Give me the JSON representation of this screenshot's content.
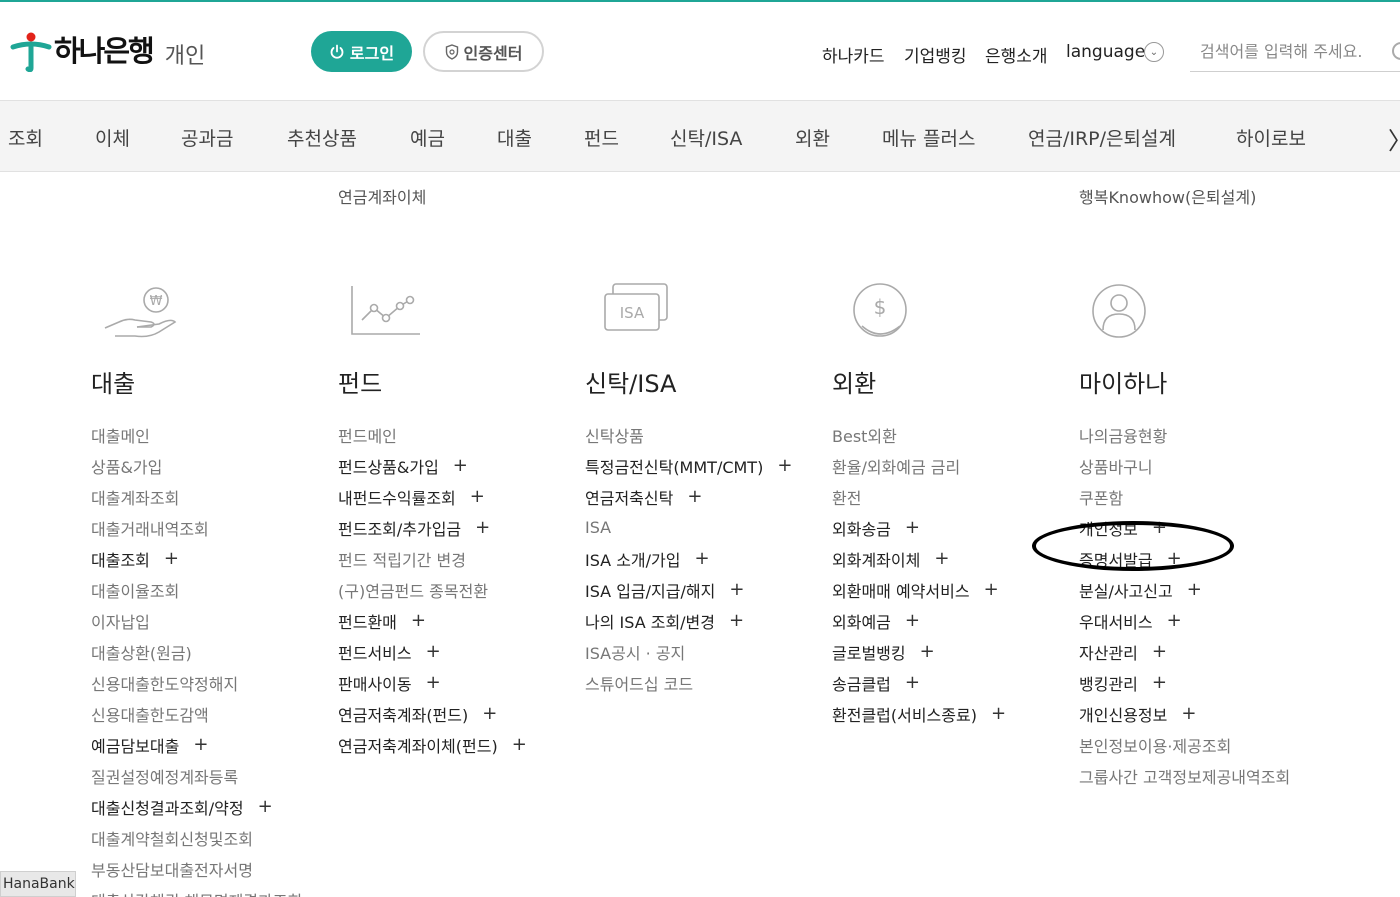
{
  "brand": {
    "name": "하나은행",
    "sub": "개인"
  },
  "header": {
    "login_label": "로그인",
    "cert_label": "인증센터",
    "util_links": [
      "하나카드",
      "기업뱅킹",
      "은행소개",
      "language"
    ],
    "search_placeholder": "검색어를 입력해 주세요."
  },
  "nav": {
    "items": [
      "조회",
      "이체",
      "공과금",
      "추천상품",
      "예금",
      "대출",
      "펀드",
      "신탁/ISA",
      "외환",
      "메뉴 플러스",
      "연금/IRP/은퇴설계",
      "하이로보"
    ],
    "next_symbol": "〉"
  },
  "partial_links": [
    "연금계좌이체",
    "행복Knowhow(은퇴설계)"
  ],
  "plus_symbol": "+",
  "menu": {
    "loan": {
      "title": "대출",
      "items": [
        {
          "label": "대출메인",
          "plus": false
        },
        {
          "label": "상품&가입",
          "plus": false
        },
        {
          "label": "대출계좌조회",
          "plus": false
        },
        {
          "label": "대출거래내역조회",
          "plus": false
        },
        {
          "label": "대출조회",
          "plus": true
        },
        {
          "label": "대출이율조회",
          "plus": false
        },
        {
          "label": "이자납입",
          "plus": false
        },
        {
          "label": "대출상환(원금)",
          "plus": false
        },
        {
          "label": "신용대출한도약정해지",
          "plus": false
        },
        {
          "label": "신용대출한도감액",
          "plus": false
        },
        {
          "label": "예금담보대출",
          "plus": true
        },
        {
          "label": "질권설정예정계좌등록",
          "plus": false
        },
        {
          "label": "대출신청결과조회/약정",
          "plus": true
        },
        {
          "label": "대출계약철회신청및조회",
          "plus": false
        },
        {
          "label": "부동산담보대출전자서명",
          "plus": false
        },
        {
          "label": "대출상각채권 채무면제결과조회",
          "plus": false
        }
      ]
    },
    "fund": {
      "title": "펀드",
      "items": [
        {
          "label": "펀드메인",
          "plus": false
        },
        {
          "label": "펀드상품&가입",
          "plus": true
        },
        {
          "label": "내펀드수익률조회",
          "plus": true
        },
        {
          "label": "펀드조회/추가입금",
          "plus": true
        },
        {
          "label": "펀드 적립기간 변경",
          "plus": false
        },
        {
          "label": "(구)연금펀드 종목전환",
          "plus": false
        },
        {
          "label": "펀드환매",
          "plus": true
        },
        {
          "label": "펀드서비스",
          "plus": true
        },
        {
          "label": "판매사이동",
          "plus": true
        },
        {
          "label": "연금저축계좌(펀드)",
          "plus": true
        },
        {
          "label": "연금저축계좌이체(펀드)",
          "plus": true
        }
      ]
    },
    "trust": {
      "title": "신탁/ISA",
      "icon_text": "ISA",
      "items": [
        {
          "label": "신탁상품",
          "plus": false
        },
        {
          "label": "특정금전신탁(MMT/CMT)",
          "plus": true
        },
        {
          "label": "연금저축신탁",
          "plus": true
        },
        {
          "label": "ISA",
          "plus": false
        },
        {
          "label": "ISA 소개/가입",
          "plus": true
        },
        {
          "label": "ISA 입금/지급/해지",
          "plus": true
        },
        {
          "label": "나의 ISA 조회/변경",
          "plus": true
        },
        {
          "label": "ISA공시 · 공지",
          "plus": false
        },
        {
          "label": "스튜어드십 코드",
          "plus": false
        }
      ]
    },
    "fx": {
      "title": "외환",
      "items": [
        {
          "label": "Best외환",
          "plus": false
        },
        {
          "label": "환율/외화예금 금리",
          "plus": false
        },
        {
          "label": "환전",
          "plus": false
        },
        {
          "label": "외화송금",
          "plus": true
        },
        {
          "label": "외화계좌이체",
          "plus": true
        },
        {
          "label": "외환매매 예약서비스",
          "plus": true
        },
        {
          "label": "외화예금",
          "plus": true
        },
        {
          "label": "글로벌뱅킹",
          "plus": true
        },
        {
          "label": "송금클럽",
          "plus": true
        },
        {
          "label": "환전클럽(서비스종료)",
          "plus": true
        }
      ]
    },
    "myhana": {
      "title": "마이하나",
      "items": [
        {
          "label": "나의금융현황",
          "plus": false
        },
        {
          "label": "상품바구니",
          "plus": false
        },
        {
          "label": "쿠폰함",
          "plus": false
        },
        {
          "label": "개인정보",
          "plus": true
        },
        {
          "label": "증명서발급",
          "plus": true,
          "active": true
        },
        {
          "label": "분실/사고신고",
          "plus": true
        },
        {
          "label": "우대서비스",
          "plus": true
        },
        {
          "label": "자산관리",
          "plus": true
        },
        {
          "label": "뱅킹관리",
          "plus": true
        },
        {
          "label": "개인신용정보",
          "plus": true
        },
        {
          "label": "본인정보이용·제공조회",
          "plus": false
        },
        {
          "label": "그룹사간 고객정보제공내역조회",
          "plus": false
        }
      ]
    }
  },
  "status_tip": "HanaBank",
  "colors": {
    "accent": "#1fa696",
    "nav_bg": "#f4f4f4",
    "logo_red": "#e2231a"
  }
}
